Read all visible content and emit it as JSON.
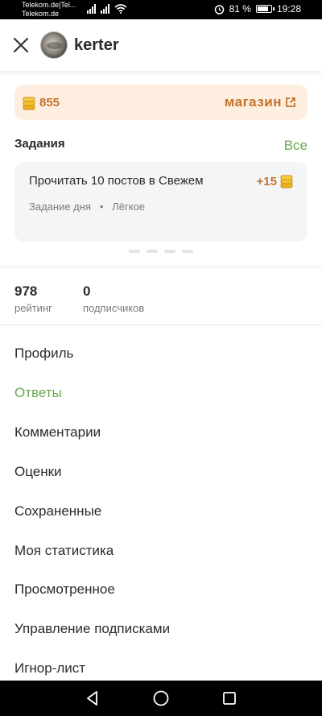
{
  "status_bar": {
    "carrier_line1": "Telekom.de|Tel...",
    "carrier_line2": "Telekom.de",
    "battery": "81 %",
    "time": "19:28"
  },
  "header": {
    "username": "kerter"
  },
  "coins": {
    "count": "855",
    "shop_label": "магазин"
  },
  "tasks": {
    "title": "Задания",
    "all_label": "Все",
    "card": {
      "name": "Прочитать 10 постов в Свежем",
      "reward": "+15",
      "type": "Задание дня",
      "separator": "•",
      "difficulty": "Лёгкое"
    }
  },
  "stats": [
    {
      "value": "978",
      "label": "рейтинг"
    },
    {
      "value": "0",
      "label": "подписчиков"
    }
  ],
  "menu": [
    {
      "label": "Профиль"
    },
    {
      "label": "Ответы"
    },
    {
      "label": "Комментарии"
    },
    {
      "label": "Оценки"
    },
    {
      "label": "Сохраненные"
    },
    {
      "label": "Моя статистика"
    },
    {
      "label": "Просмотренное"
    },
    {
      "label": "Управление подписками"
    },
    {
      "label": "Игнор-лист"
    }
  ],
  "colors": {
    "accent_green": "#6aa84f",
    "coin_orange": "#c2742c",
    "coin_bar_bg": "#fdeee0"
  },
  "icons": [
    "close-icon",
    "coin-icon",
    "external-link-icon",
    "back-icon",
    "home-icon",
    "recents-icon"
  ]
}
